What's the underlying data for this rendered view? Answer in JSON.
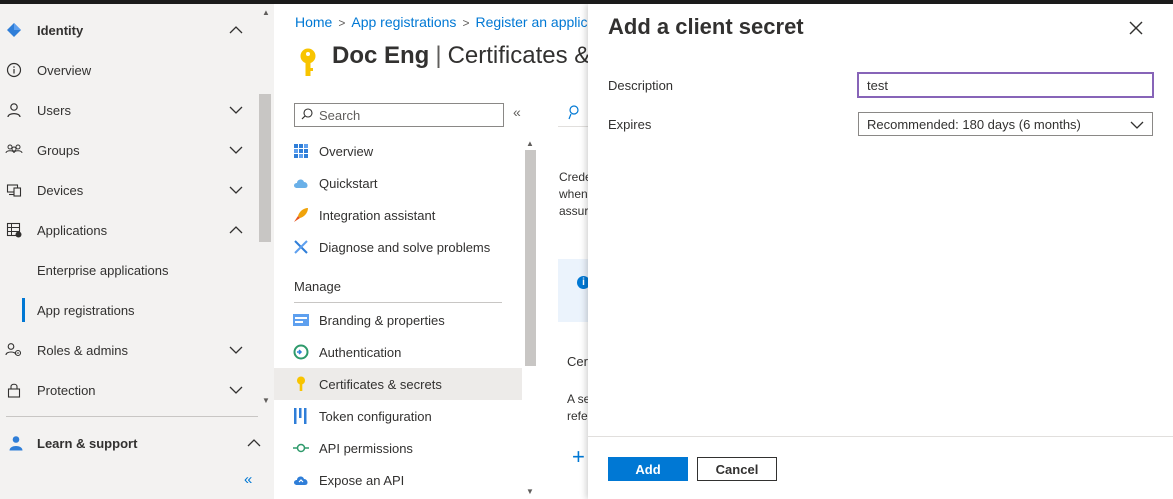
{
  "left_nav": {
    "items": [
      {
        "label": "Identity",
        "icon": "identity-diamond-icon",
        "chevron": "up"
      },
      {
        "label": "Overview",
        "icon": "info-circle-icon"
      },
      {
        "label": "Users",
        "icon": "user-icon",
        "chevron": "down"
      },
      {
        "label": "Groups",
        "icon": "groups-icon",
        "chevron": "down"
      },
      {
        "label": "Devices",
        "icon": "devices-icon",
        "chevron": "down"
      },
      {
        "label": "Applications",
        "icon": "applications-icon",
        "chevron": "up"
      },
      {
        "label": "Enterprise applications"
      },
      {
        "label": "App registrations",
        "selected": true
      },
      {
        "label": "Roles & admins",
        "icon": "roles-icon",
        "chevron": "down"
      },
      {
        "label": "Protection",
        "icon": "lock-icon",
        "chevron": "down"
      },
      {
        "label": "Learn & support",
        "icon": "person-icon",
        "chevron": "up"
      }
    ],
    "collapse_glyph": "«"
  },
  "breadcrumb": {
    "home": "Home",
    "app_registrations": "App registrations",
    "register": "Register an applic"
  },
  "page": {
    "title_app": "Doc Eng",
    "title_page": "Certificates &",
    "pipe": "|"
  },
  "menu": {
    "search_placeholder": "Search",
    "collapse_glyph": "«",
    "items": [
      {
        "label": "Overview",
        "icon": "grid-icon"
      },
      {
        "label": "Quickstart",
        "icon": "cloud-icon"
      },
      {
        "label": "Integration assistant",
        "icon": "rocket-icon"
      },
      {
        "label": "Diagnose and solve problems",
        "icon": "wrench-icon"
      }
    ],
    "section": "Manage",
    "manage_items": [
      {
        "label": "Branding & properties",
        "icon": "branding-icon"
      },
      {
        "label": "Authentication",
        "icon": "authentication-icon"
      },
      {
        "label": "Certificates & secrets",
        "icon": "key-icon",
        "active": true
      },
      {
        "label": "Token configuration",
        "icon": "token-bars-icon"
      },
      {
        "label": "API permissions",
        "icon": "api-permissions-icon"
      },
      {
        "label": "Expose an API",
        "icon": "cloud-api-icon"
      }
    ]
  },
  "behind_content": {
    "line1": "Crede",
    "line2": "when",
    "line3": "assur",
    "line4": "Cer",
    "line5": "A se",
    "line6": "refe",
    "plus": "+"
  },
  "panel": {
    "title": "Add a client secret",
    "description_label": "Description",
    "description_value": "test",
    "expires_label": "Expires",
    "expires_value": "Recommended: 180 days (6 months)",
    "add_label": "Add",
    "cancel_label": "Cancel"
  },
  "colors": {
    "accent": "#0078d4",
    "focus_border": "#8764b8",
    "nav_background": "#f3f2f1"
  }
}
